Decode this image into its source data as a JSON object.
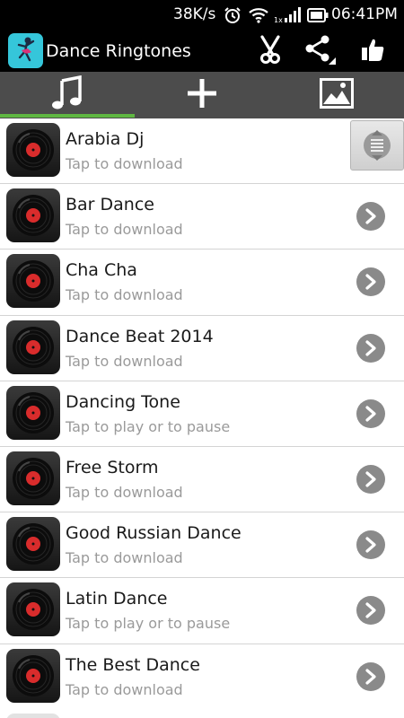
{
  "status_bar": {
    "speed": "38K/s",
    "time": "06:41PM",
    "icons": [
      "alarm-icon",
      "wifi-icon",
      "signal-icon",
      "battery-icon"
    ]
  },
  "action_bar": {
    "title": "Dance Ringtones",
    "actions": [
      "scissors-icon",
      "share-icon",
      "thumbs-up-icon"
    ]
  },
  "tabs": [
    {
      "name": "music",
      "icon": "music-note-icon",
      "selected": true
    },
    {
      "name": "add",
      "icon": "plus-icon",
      "selected": false
    },
    {
      "name": "wallpaper",
      "icon": "picture-icon",
      "selected": false
    }
  ],
  "colors": {
    "tab_bar": "#4c4c4c",
    "tab_indicator": "#5fb742",
    "app_icon_bg": "#35c6da",
    "record_label": "#d92c2c"
  },
  "ringtones": [
    {
      "title": "Arabia Dj",
      "subtitle": "Tap to download"
    },
    {
      "title": "Bar Dance",
      "subtitle": "Tap to download"
    },
    {
      "title": "Cha Cha",
      "subtitle": "Tap to download"
    },
    {
      "title": "Dance Beat 2014",
      "subtitle": "Tap to download"
    },
    {
      "title": "Dancing Tone",
      "subtitle": "Tap to play or to pause"
    },
    {
      "title": "Free Storm",
      "subtitle": "Tap to download"
    },
    {
      "title": "Good Russian Dance",
      "subtitle": "Tap to download"
    },
    {
      "title": "Latin Dance",
      "subtitle": "Tap to play or to pause"
    },
    {
      "title": "The Best Dance",
      "subtitle": "Tap to download"
    }
  ]
}
